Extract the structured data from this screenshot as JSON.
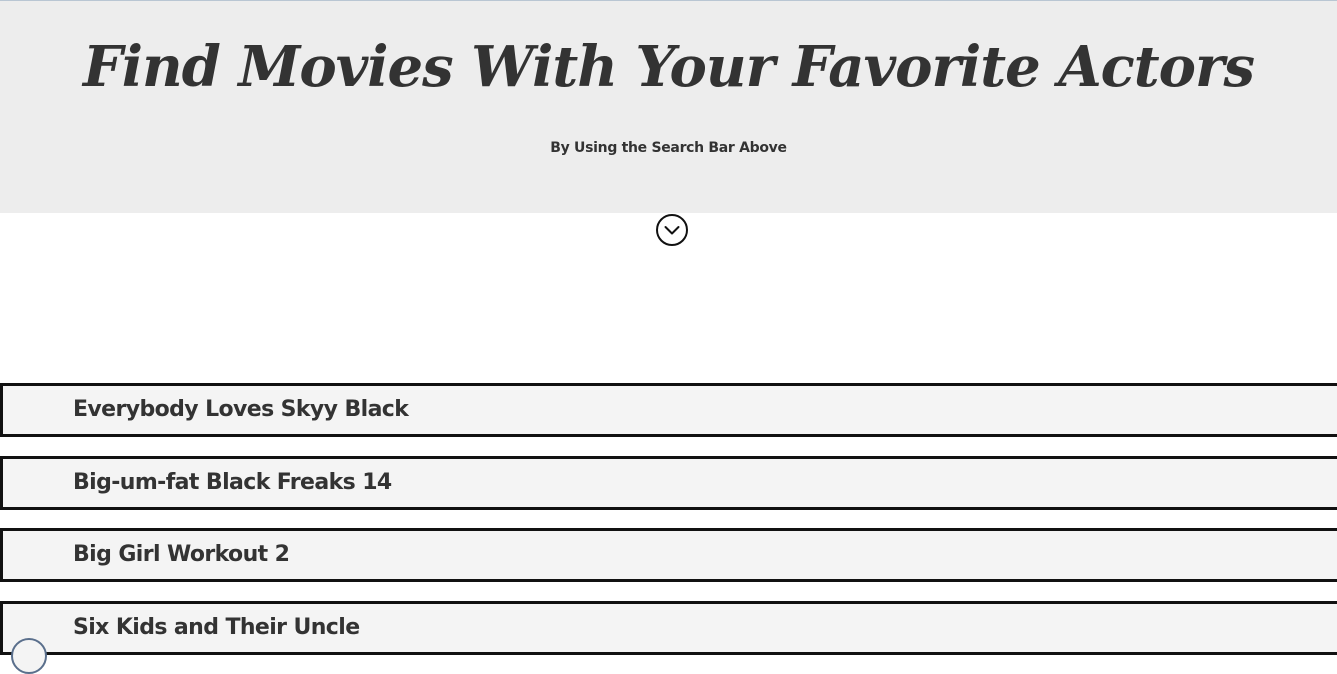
{
  "hero": {
    "title": "Find Movies With Your Favorite Actors",
    "subtitle": "By Using the Search Bar Above",
    "scroll_icon": "chevron-down-circle-icon"
  },
  "results": [
    {
      "title": "Everybody Loves Skyy Black"
    },
    {
      "title": "Big-um-fat Black Freaks 14"
    },
    {
      "title": "Big Girl Workout 2"
    },
    {
      "title": "Six Kids and Their Uncle"
    }
  ],
  "colors": {
    "hero_background": "#ededed",
    "text": "#333333",
    "row_background": "#f4f4f4",
    "row_border": "#111111"
  }
}
